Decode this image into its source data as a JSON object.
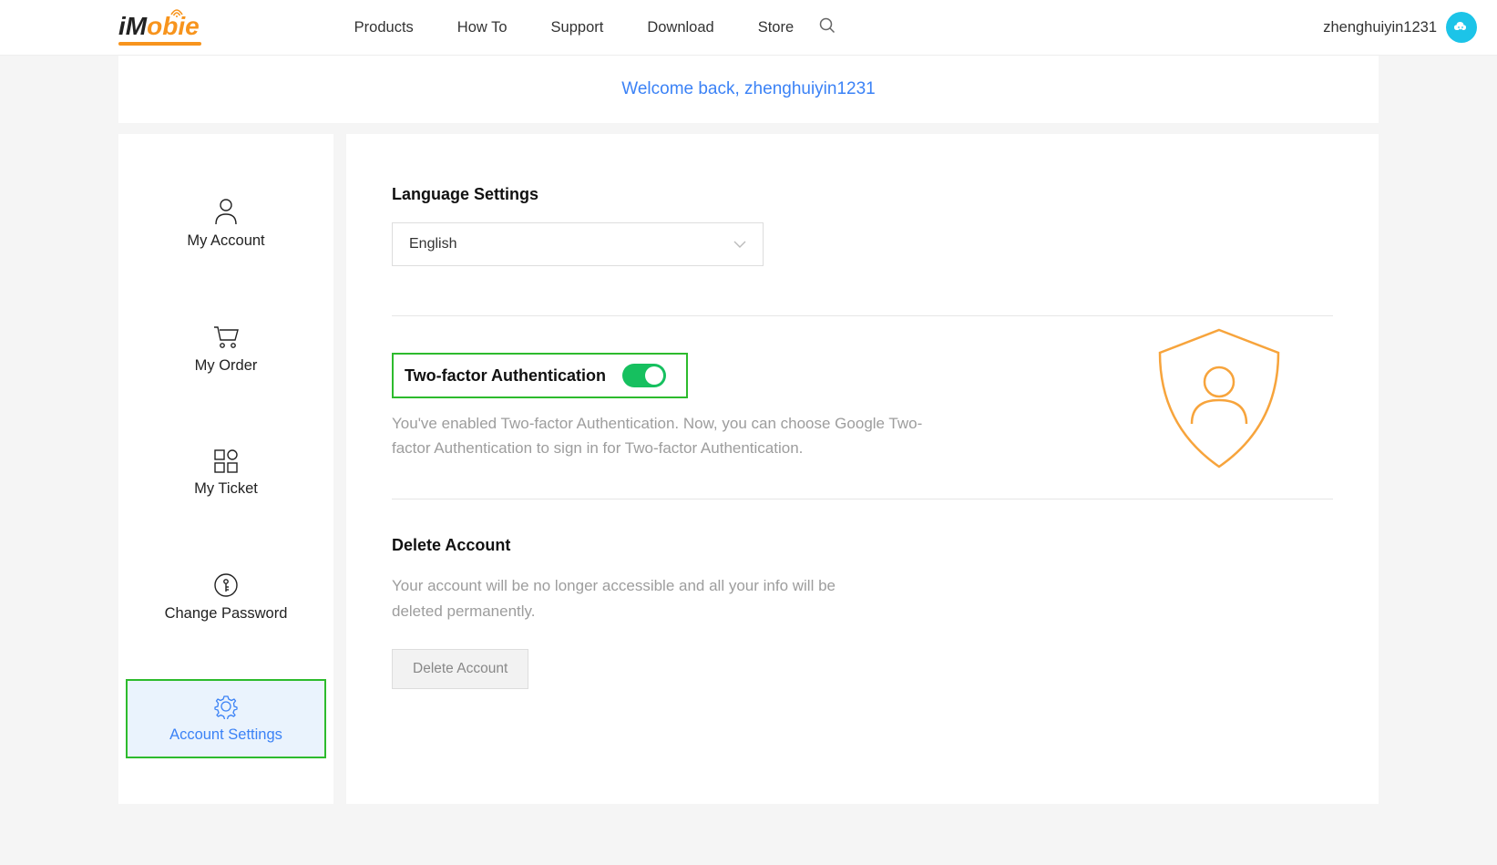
{
  "brand": {
    "prefix": "iM",
    "suffix": "obie"
  },
  "nav": {
    "products": "Products",
    "howto": "How To",
    "support": "Support",
    "download": "Download",
    "store": "Store"
  },
  "user": {
    "name": "zhenghuiyin1231"
  },
  "welcome": "Welcome back, zhenghuiyin1231",
  "sidebar": {
    "account": "My Account",
    "order": "My Order",
    "ticket": "My Ticket",
    "password": "Change Password",
    "settings": "Account Settings"
  },
  "language": {
    "title": "Language Settings",
    "value": "English"
  },
  "tfa": {
    "title": "Two-factor Authentication",
    "desc": "You've enabled Two-factor Authentication. Now, you can choose Google Two-factor Authentication to sign in for Two-factor Authentication."
  },
  "deleteSection": {
    "title": "Delete Account",
    "desc": "Your account will be no longer accessible and all your info will be deleted permanently.",
    "button": "Delete Account"
  }
}
